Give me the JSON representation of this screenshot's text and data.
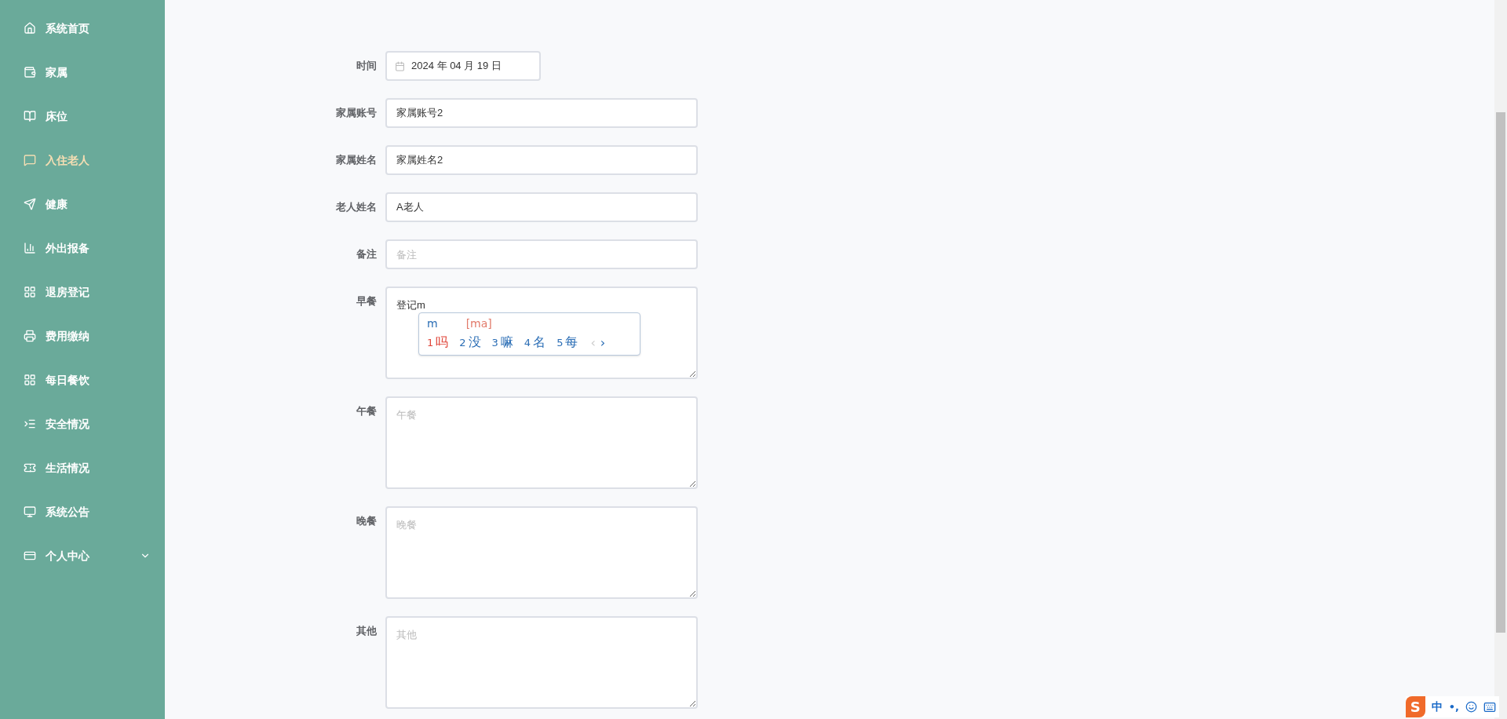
{
  "sidebar": {
    "items": [
      {
        "label": "系统首页",
        "selected": false,
        "expandable": false
      },
      {
        "label": "家属",
        "selected": false,
        "expandable": false
      },
      {
        "label": "床位",
        "selected": false,
        "expandable": false
      },
      {
        "label": "入住老人",
        "selected": true,
        "expandable": false
      },
      {
        "label": "健康",
        "selected": false,
        "expandable": false
      },
      {
        "label": "外出报备",
        "selected": false,
        "expandable": false
      },
      {
        "label": "退房登记",
        "selected": false,
        "expandable": false
      },
      {
        "label": "费用缴纳",
        "selected": false,
        "expandable": false
      },
      {
        "label": "每日餐饮",
        "selected": false,
        "expandable": false
      },
      {
        "label": "安全情况",
        "selected": false,
        "expandable": false
      },
      {
        "label": "生活情况",
        "selected": false,
        "expandable": false
      },
      {
        "label": "系统公告",
        "selected": false,
        "expandable": false
      },
      {
        "label": "个人中心",
        "selected": false,
        "expandable": true
      }
    ]
  },
  "form": {
    "fields": [
      {
        "label": "时间",
        "kind": "date",
        "value": "2024 年 04 月 19 日"
      },
      {
        "label": "家属账号",
        "kind": "input",
        "value": "家属账号2"
      },
      {
        "label": "家属姓名",
        "kind": "input",
        "value": "家属姓名2"
      },
      {
        "label": "老人姓名",
        "kind": "input",
        "value": "A老人"
      },
      {
        "label": "备注",
        "kind": "input",
        "placeholder": "备注"
      },
      {
        "label": "早餐",
        "kind": "textarea",
        "value": "登记m"
      },
      {
        "label": "午餐",
        "kind": "textarea",
        "placeholder": "午餐"
      },
      {
        "label": "晚餐",
        "kind": "textarea",
        "placeholder": "晚餐"
      },
      {
        "label": "其他",
        "kind": "textarea",
        "placeholder": "其他"
      }
    ]
  },
  "ime_popup": {
    "input": "m",
    "pinyin": "[ma]",
    "candidates": [
      {
        "index": "1",
        "text": "吗",
        "selected": true
      },
      {
        "index": "2",
        "text": "没",
        "selected": false
      },
      {
        "index": "3",
        "text": "嘛",
        "selected": false
      },
      {
        "index": "4",
        "text": "名",
        "selected": false
      },
      {
        "index": "5",
        "text": "每",
        "selected": false
      }
    ],
    "prev": "‹",
    "next": "›"
  },
  "ime_bar": {
    "logo": "S",
    "mode": "中",
    "punct": "•,"
  }
}
